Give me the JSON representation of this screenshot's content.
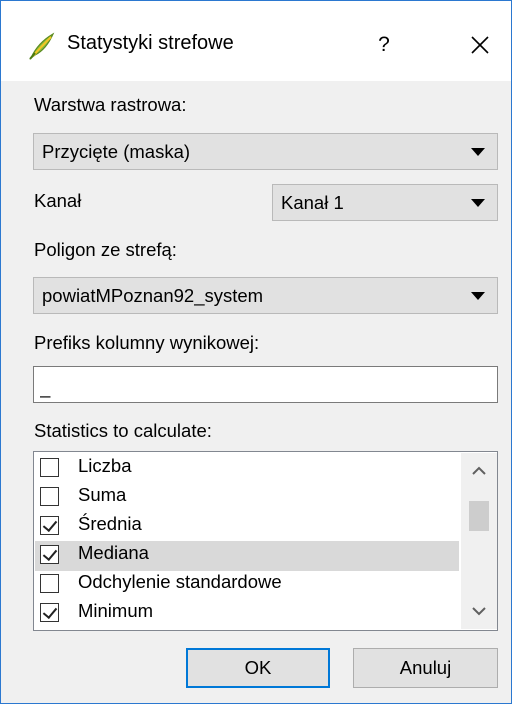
{
  "window": {
    "title": "Statystyki strefowe",
    "help_label": "?",
    "icon": "qgis-icon",
    "close_icon": "close-icon"
  },
  "raster_layer": {
    "label": "Warstwa rastrowa:",
    "value": "Przycięte (maska)"
  },
  "band": {
    "label": "Kanał",
    "value": "Kanał 1"
  },
  "zone_polygon": {
    "label": "Poligon ze strefą:",
    "value": "powiatMPoznan92_system"
  },
  "output_prefix": {
    "label": "Prefiks kolumny wynikowej:",
    "value": "_"
  },
  "statistics": {
    "label": "Statistics to calculate:",
    "items": [
      {
        "label": "Liczba",
        "checked": false,
        "selected": false
      },
      {
        "label": "Suma",
        "checked": false,
        "selected": false
      },
      {
        "label": "Średnia",
        "checked": true,
        "selected": false
      },
      {
        "label": "Mediana",
        "checked": true,
        "selected": true
      },
      {
        "label": "Odchylenie standardowe",
        "checked": false,
        "selected": false
      },
      {
        "label": "Minimum",
        "checked": true,
        "selected": false
      }
    ],
    "scroll_up_icon": "chevron-up-icon",
    "scroll_down_icon": "chevron-down-icon"
  },
  "buttons": {
    "ok": "OK",
    "cancel": "Anuluj"
  },
  "colors": {
    "accent": "#0078d7",
    "window_border": "#2b78d0",
    "dialog_bg": "#f0f0f0",
    "selection": "#d9d9d9"
  }
}
